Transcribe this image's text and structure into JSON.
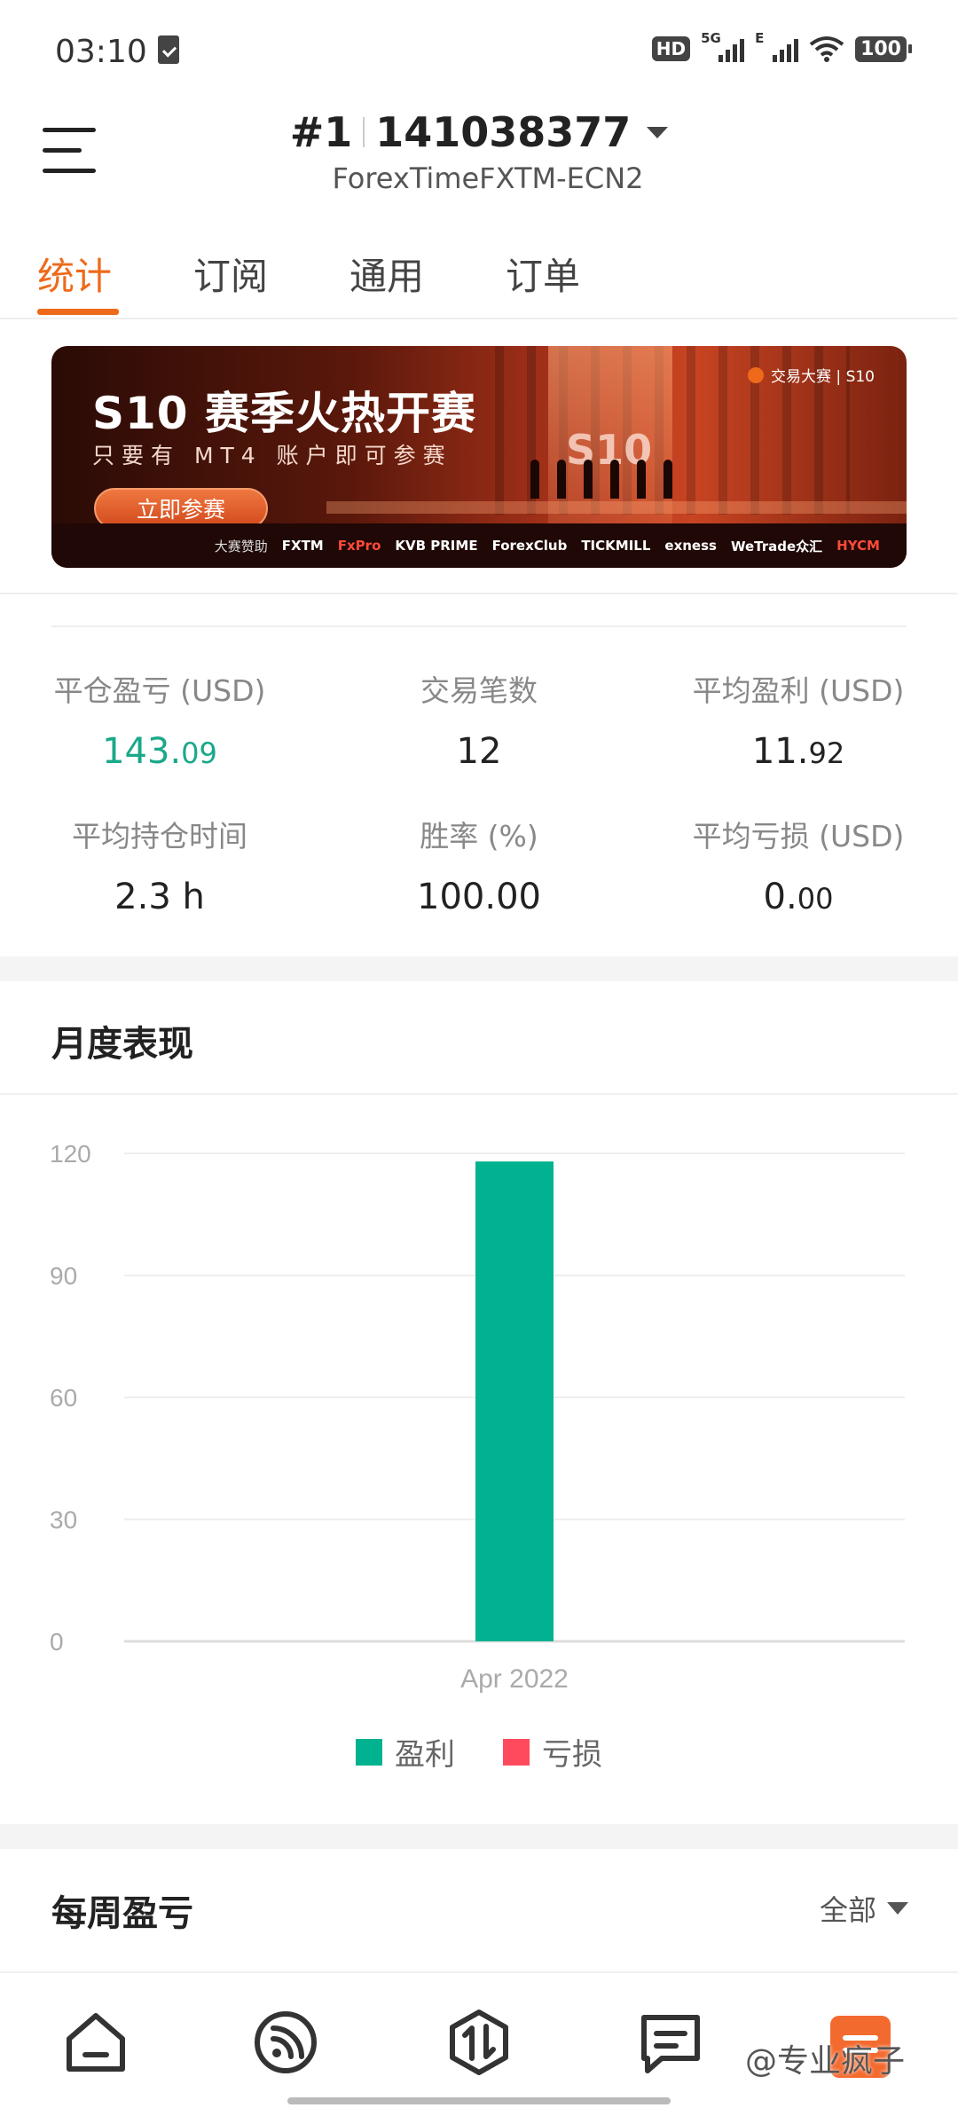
{
  "status_bar": {
    "time": "03:10",
    "hd_label": "HD",
    "net1_label": "5G",
    "net2_label": "E",
    "battery": "100"
  },
  "header": {
    "account_index": "#1",
    "account_number": "141038377",
    "server": "ForexTimeFXTM-ECN2",
    "icons": [
      "menu-icon",
      "dropdown-caret-icon"
    ]
  },
  "tabs": [
    {
      "label": "统计",
      "active": true
    },
    {
      "label": "订阅",
      "active": false
    },
    {
      "label": "通用",
      "active": false
    },
    {
      "label": "订单",
      "active": false
    }
  ],
  "banner": {
    "title": "S10 赛季火热开赛",
    "subtitle": "只要有 MT4 账户即可参赛",
    "cta": "立即参赛",
    "brand": "交易大赛 | S10",
    "stage_text": "S10",
    "sponsor_label": "大赛赞助",
    "sponsors": [
      "FXTM",
      "FxPro",
      "KVB PRIME",
      "ForexClub",
      "TICKMILL",
      "exness",
      "WeTrade众汇",
      "HYCM"
    ]
  },
  "stats": {
    "closed_pnl": {
      "label": "平仓盈亏 (USD)",
      "int": "143.",
      "dec": "09",
      "color": "#1aa88a"
    },
    "trades": {
      "label": "交易笔数",
      "value": "12"
    },
    "avg_profit": {
      "label": "平均盈利 (USD)",
      "int": "11.",
      "dec": "92"
    },
    "avg_hold": {
      "label": "平均持仓时间",
      "value": "2.3 h"
    },
    "win_rate": {
      "label": "胜率 (%)",
      "value": "100.00"
    },
    "avg_loss": {
      "label": "平均亏损 (USD)",
      "int": "0.",
      "dec": "00"
    }
  },
  "monthly": {
    "title": "月度表现"
  },
  "chart_data": {
    "type": "bar",
    "categories": [
      "Apr 2022"
    ],
    "series": [
      {
        "name": "盈利",
        "values": [
          118
        ],
        "color": "#00b28f"
      },
      {
        "name": "亏损",
        "values": [
          0
        ],
        "color": "#ff4a5e"
      }
    ],
    "yticks": [
      0,
      30,
      60,
      90,
      120
    ],
    "ylim": [
      0,
      120
    ],
    "grid": true,
    "legend": "bottom-center"
  },
  "weekly": {
    "title": "每周盈亏",
    "filter": "全部"
  },
  "bottom_nav": {
    "items": [
      "home-icon",
      "signal-icon",
      "trade-icon",
      "message-icon",
      "profile-icon"
    ]
  },
  "watermark": "@专业疯子"
}
